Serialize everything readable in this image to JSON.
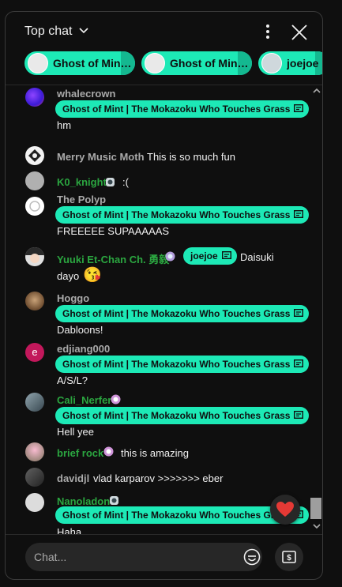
{
  "header": {
    "title": "Top chat"
  },
  "tickers": [
    {
      "name": "Ghost of Mint ..."
    },
    {
      "name": "Ghost of Mint ..."
    },
    {
      "name": "joejoe"
    }
  ],
  "reply_label": "Ghost of Mint | The Mokazoku Who Touches Grass",
  "messages": [
    {
      "author": "whalecrown",
      "text": "hm"
    },
    {
      "author": "Merry Music Moth",
      "text": "This is so much fun"
    },
    {
      "author": "K0_knight",
      "text": ":("
    },
    {
      "author": "The Polyp",
      "text": "FREEEEE SUPAAAAAS"
    },
    {
      "author": "Yuuki Et-Chan Ch. 勇毅",
      "reply": "joejoe",
      "text": "Daisuki",
      "text2": "dayo",
      "emoji": "😘"
    },
    {
      "author": "Hoggo",
      "text": "Dabloons!"
    },
    {
      "author": "edjiang000",
      "avatar_letter": "e",
      "text": "A/S/L?"
    },
    {
      "author": "Cali_Nerfer",
      "text": "Hell yee"
    },
    {
      "author": "brief rock",
      "text": "this is amazing"
    },
    {
      "author": "davidjl",
      "text": "vlad karparov >>>>>>> eber"
    },
    {
      "author": "Nanoladon",
      "text": "Haha"
    }
  ],
  "heart_emoji": "❤️",
  "input": {
    "placeholder": "Chat..."
  },
  "colors": {
    "accent": "#1de9b6",
    "member": "#2ba640",
    "background": "#0f0f0f"
  },
  "icons": [
    "chevron-down-icon",
    "more-vert-icon",
    "close-icon",
    "reply-icon",
    "member-badge-icon",
    "emoji-icon",
    "super-chat-icon",
    "heart-icon"
  ]
}
